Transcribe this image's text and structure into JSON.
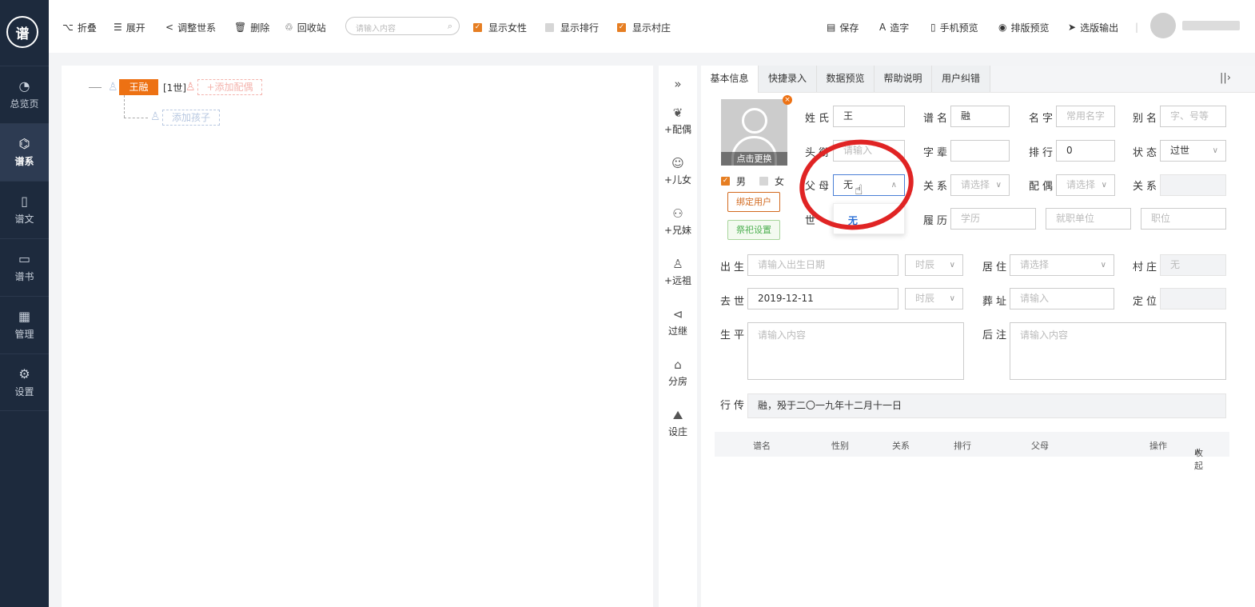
{
  "sidebar": {
    "logo": "谱",
    "items": [
      {
        "label": "总览页",
        "icon": "pie-chart-icon"
      },
      {
        "label": "谱系",
        "icon": "tree-icon"
      },
      {
        "label": "谱文",
        "icon": "document-icon"
      },
      {
        "label": "谱书",
        "icon": "book-icon"
      },
      {
        "label": "管理",
        "icon": "grid-icon"
      },
      {
        "label": "设置",
        "icon": "gear-icon"
      }
    ],
    "active": "谱系"
  },
  "toolbar": {
    "collapse": "折叠",
    "expand": "展开",
    "adjust": "调整世系",
    "delete": "删除",
    "recycle": "回收站",
    "search_placeholder": "请输入内容",
    "show_female": "显示女性",
    "show_rank": "显示排行",
    "show_village": "显示村庄",
    "save": "保存",
    "make_char": "造字",
    "mobile_preview": "手机预览",
    "layout_preview": "排版预览",
    "export": "选版输出"
  },
  "tree": {
    "root_name": "王融",
    "generation": "[1世]",
    "add_spouse": "+添加配偶",
    "add_child": "添加孩子"
  },
  "tools": [
    {
      "label": "+配偶",
      "icon": "spouse-icon"
    },
    {
      "label": "+儿女",
      "icon": "child-icon"
    },
    {
      "label": "+兄妹",
      "icon": "siblings-icon"
    },
    {
      "label": "+远祖",
      "icon": "ancestor-icon"
    },
    {
      "label": "过继",
      "icon": "adopt-icon"
    },
    {
      "label": "分房",
      "icon": "house-icon"
    },
    {
      "label": "设庄",
      "icon": "mountain-icon"
    }
  ],
  "tabs": [
    "基本信息",
    "快捷录入",
    "数据预览",
    "帮助说明",
    "用户纠错"
  ],
  "form": {
    "photo_caption": "点击更换",
    "gender_male": "男",
    "gender_female": "女",
    "bind_user": "绑定用户",
    "sacrifice": "祭祀设置",
    "surname_label": "姓氏",
    "surname_value": "王",
    "genealogy_name_label": "谱名",
    "genealogy_name_value": "融",
    "name_label": "名字",
    "name_placeholder": "常用名字",
    "alias_label": "别名",
    "alias_placeholder": "字、号等",
    "title_label": "头衔",
    "title_placeholder": "请输入",
    "zibei_label": "字辈",
    "zibei_value": "",
    "rank_label": "排行",
    "rank_value": "0",
    "status_label": "状态",
    "status_value": "过世",
    "parents_label": "父母",
    "parents_value": "无",
    "relation_label": "关系",
    "relation_placeholder": "请选择",
    "spouse_label": "配偶",
    "spouse_placeholder": "请选择",
    "relation2_label": "关系",
    "generation_label": "世",
    "resume_label": "履历",
    "education_placeholder": "学历",
    "employer_placeholder": "就职单位",
    "position_placeholder": "职位",
    "birth_label": "出生",
    "birth_placeholder": "请输入出生日期",
    "birth_time_placeholder": "时辰",
    "residence_label": "居住",
    "residence_placeholder": "请选择",
    "village_label": "村庄",
    "village_value": "无",
    "death_label": "去世",
    "death_value": "2019-12-11",
    "death_time_placeholder": "时辰",
    "burial_label": "葬址",
    "burial_placeholder": "请输入",
    "locate_label": "定位",
    "biography_label": "生平",
    "biography_placeholder": "请输入内容",
    "note_label": "后注",
    "note_placeholder": "请输入内容",
    "xingzhuan_label": "行传",
    "xingzhuan_value": "融，殁于二〇一九年十二月十一日"
  },
  "dropdown_option": "无",
  "table": {
    "headers": [
      "谱名",
      "性别",
      "关系",
      "排行",
      "父母",
      "操作"
    ],
    "collapse": "收起"
  },
  "colors": {
    "accent": "#ed7113",
    "sidebar": "#1d2a3d",
    "highlight": "#e02424"
  }
}
